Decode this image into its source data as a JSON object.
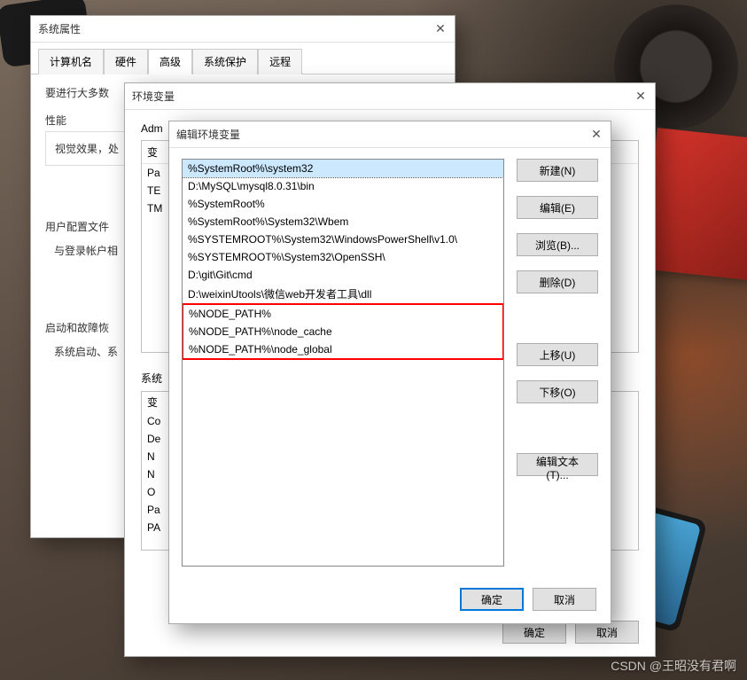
{
  "sysprops": {
    "title": "系统属性",
    "tabs": [
      "计算机名",
      "硬件",
      "高级",
      "系统保护",
      "远程"
    ],
    "active_tab_index": 2,
    "intro": "要进行大多数",
    "perf_group": "性能",
    "perf_text": "视觉效果，处",
    "userprofile_group": "用户配置文件",
    "userprofile_text": "与登录帐户相",
    "startup_group": "启动和故障恢",
    "startup_text": "系统启动、系"
  },
  "envvars": {
    "title": "环境变量",
    "user_section": "Adm",
    "sys_section": "系统",
    "col_var": "变",
    "user_rows": [
      "Pa",
      "TE",
      "TM"
    ],
    "sys_rows": [
      "变",
      "Co",
      "De",
      "N",
      "N",
      "O",
      "Pa",
      "PA"
    ],
    "ok": "确定",
    "cancel": "取消"
  },
  "editenv": {
    "title": "编辑环境变量",
    "paths": [
      "%SystemRoot%\\system32",
      "D:\\MySQL\\mysql8.0.31\\bin",
      "%SystemRoot%",
      "%SystemRoot%\\System32\\Wbem",
      "%SYSTEMROOT%\\System32\\WindowsPowerShell\\v1.0\\",
      "%SYSTEMROOT%\\System32\\OpenSSH\\",
      "D:\\git\\Git\\cmd",
      "D:\\weixinUtools\\微信web开发者工具\\dll",
      "%NODE_PATH%",
      "%NODE_PATH%\\node_cache",
      "%NODE_PATH%\\node_global"
    ],
    "highlight_start": 8,
    "highlight_end": 10,
    "buttons": {
      "new": "新建(N)",
      "edit": "编辑(E)",
      "browse": "浏览(B)...",
      "delete": "删除(D)",
      "moveup": "上移(U)",
      "movedown": "下移(O)",
      "edittext": "编辑文本(T)..."
    },
    "ok": "确定",
    "cancel": "取消"
  },
  "watermark": "CSDN @王昭没有君啊"
}
